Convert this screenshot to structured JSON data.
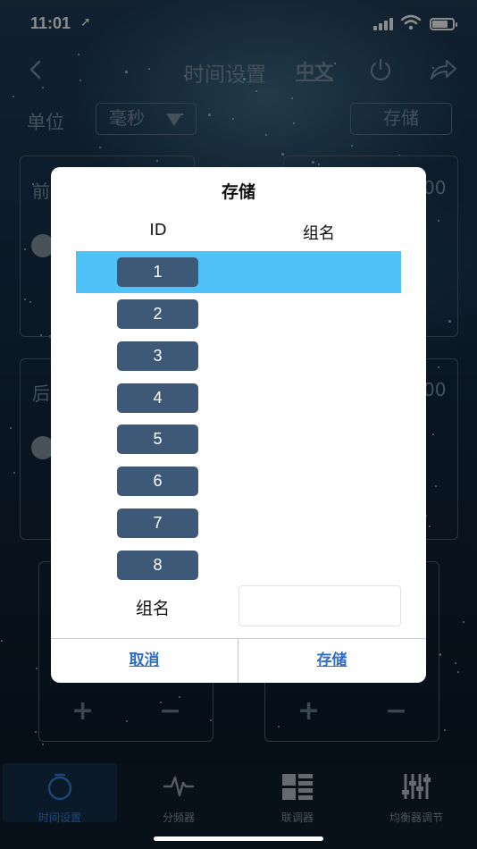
{
  "status_bar": {
    "time": "11:01"
  },
  "nav": {
    "title": "时间设置",
    "language": "中文"
  },
  "unit": {
    "label": "单位",
    "value": "毫秒"
  },
  "store_button": "存储",
  "background_panels": {
    "front_label": "前",
    "rear_label": "后",
    "front_value_tail": "00",
    "rear_value_tail": "00",
    "plus": "+",
    "minus": "−"
  },
  "dialog": {
    "title": "存储",
    "col_id": "ID",
    "col_group_name": "组名",
    "ids": [
      "1",
      "2",
      "3",
      "4",
      "5",
      "6",
      "7",
      "8"
    ],
    "selected_id": "1",
    "group_name_label": "组名",
    "group_name_value": "",
    "cancel": "取消",
    "save": "存储"
  },
  "tabs": [
    {
      "label": "时间设置",
      "icon": "stopwatch-icon",
      "active": true
    },
    {
      "label": "分频器",
      "icon": "waveform-icon",
      "active": false
    },
    {
      "label": "联调器",
      "icon": "grid-bars-icon",
      "active": false
    },
    {
      "label": "均衡器调节",
      "icon": "equalizer-sliders-icon",
      "active": false
    }
  ],
  "colors": {
    "accent": "#4fc3f7",
    "id_button": "#3e5878",
    "link": "#2f6cc7",
    "active_tab": "#3a7fd4"
  }
}
